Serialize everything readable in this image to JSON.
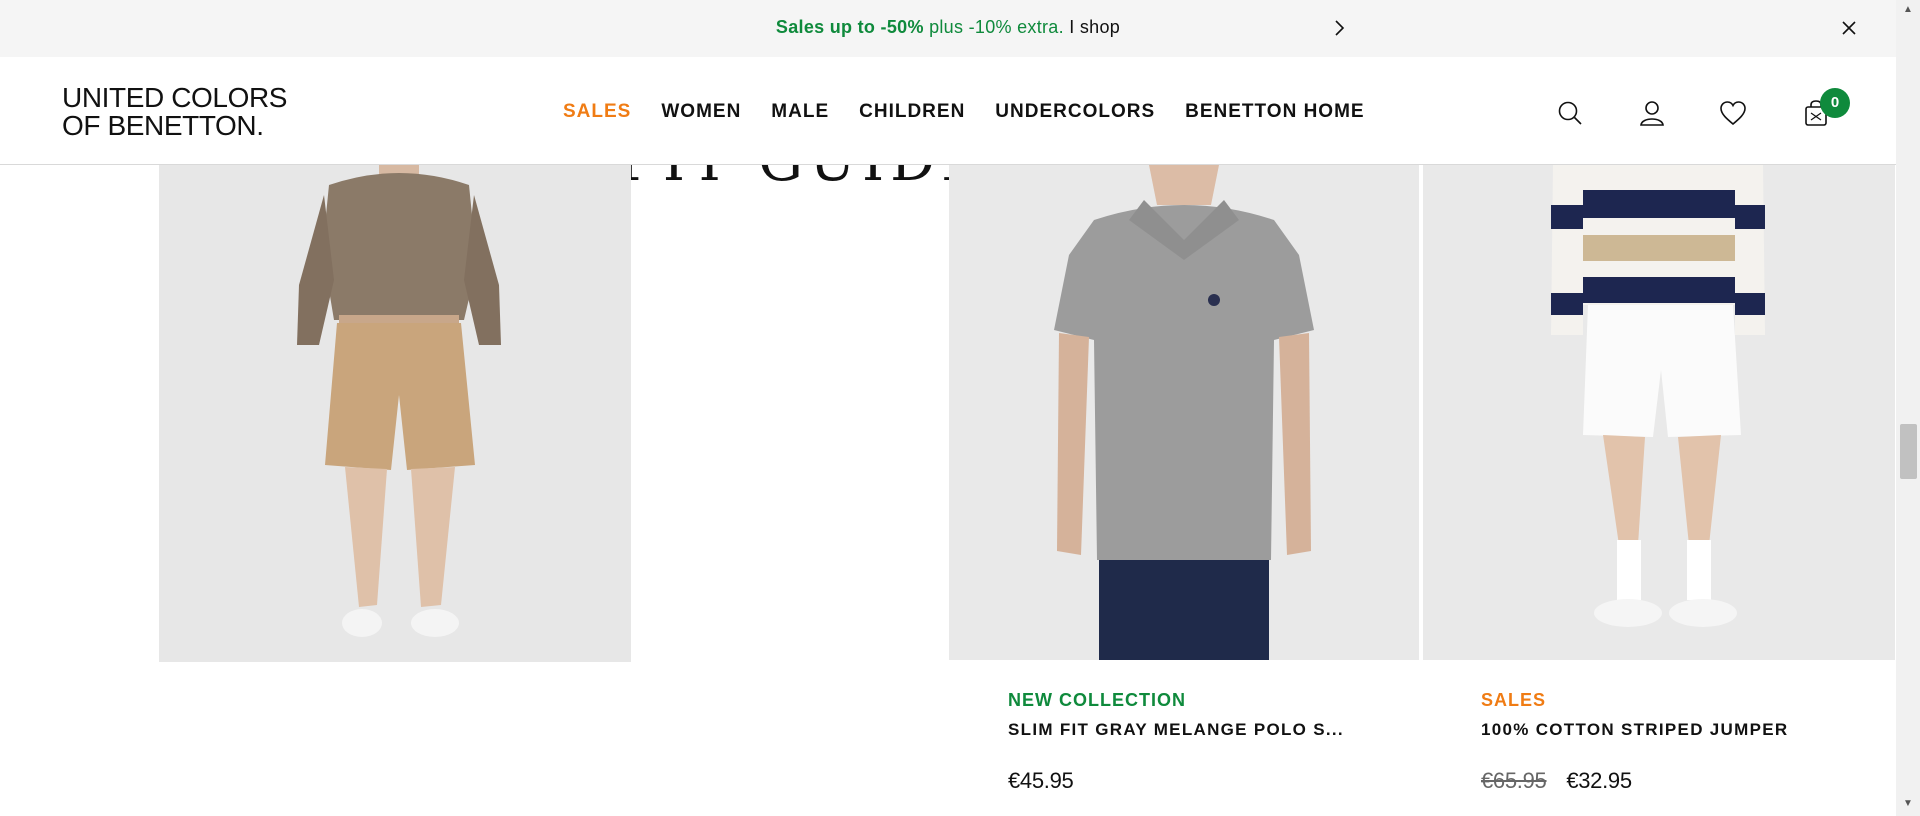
{
  "promo": {
    "strong_text": "Sales up to -50%",
    "extra_text": "plus -10% extra.",
    "cta": "I shop"
  },
  "header": {
    "logo_line1": "UNITED COLORS",
    "logo_line2": "OF BENETTON.",
    "nav": [
      "SALES",
      "WOMEN",
      "MALE",
      "CHILDREN",
      "UNDERCOLORS",
      "BENETTON HOME"
    ],
    "cart_count": "0",
    "icons": [
      "search-icon",
      "user-icon",
      "heart-icon",
      "bag-icon"
    ],
    "accent_green": "#0f8a3c",
    "accent_orange": "#f07c14"
  },
  "content": {
    "hero_heading": "FIT GUIDE",
    "products": [
      {
        "tag": "NEW COLLECTION",
        "name": "SLIM FIT GRAY MELANGE POLO S...",
        "price": "€45.95"
      },
      {
        "tag": "SALES",
        "name": "100% COTTON STRIPED JUMPER",
        "old_price": "€65.95",
        "price": "€32.95"
      }
    ]
  }
}
